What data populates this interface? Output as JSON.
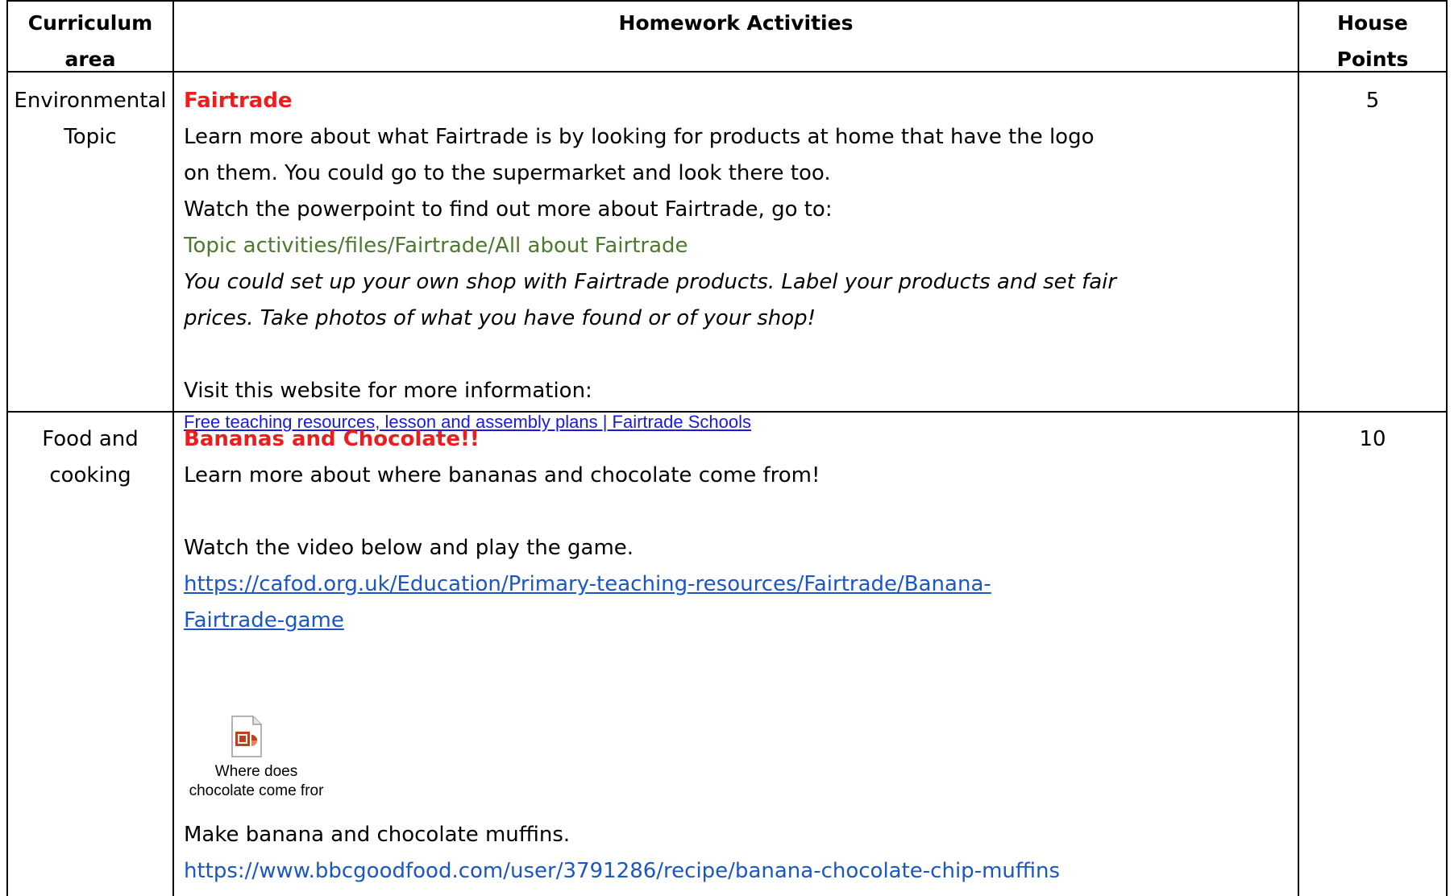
{
  "header": {
    "col1": [
      "Curriculum",
      "area"
    ],
    "col2": "Homework Activities",
    "col3": [
      "House",
      "Points"
    ]
  },
  "rows": [
    {
      "area": [
        "Environmental",
        "Topic"
      ],
      "points": "5",
      "title": "Fairtrade",
      "lines": [
        "Learn more about what Fairtrade is by looking for products at home that have the logo",
        "on them. You could go to the supermarket and look there too.",
        "Watch the powerpoint to find out more about Fairtrade, go to:"
      ],
      "path": "Topic activities/files/Fairtrade/All about Fairtrade",
      "italic_lines": [
        "You could set up your own shop with Fairtrade products. Label your products and set fair",
        "prices. Take photos of what you have found or of your shop!"
      ],
      "visit": "Visit this website for more information:",
      "link": "Free teaching resources, lesson and assembly plans | Fairtrade Schools"
    },
    {
      "area": [
        "Food and",
        "cooking"
      ],
      "points": "10",
      "title": "Bananas and Chocolate!!",
      "intro": "Learn more about where bananas and chocolate come from!",
      "watch": "Watch the video below and play the game.",
      "game_link": [
        "https://cafod.org.uk/Education/Primary-teaching-resources/Fairtrade/Banana-",
        "Fairtrade-game"
      ],
      "attachment": {
        "icon": "powerpoint-file-icon",
        "caption": [
          "Where does",
          "chocolate come fror"
        ]
      },
      "muffins": "Make banana and chocolate muffins.",
      "recipe_link": "https://www.bbcgoodfood.com/user/3791286/recipe/banana-chocolate-chip-muffins"
    }
  ],
  "colors": {
    "title_red": "#ee1c1c",
    "path_green": "#4b7a2e",
    "link_blue": "#1a56c6"
  }
}
